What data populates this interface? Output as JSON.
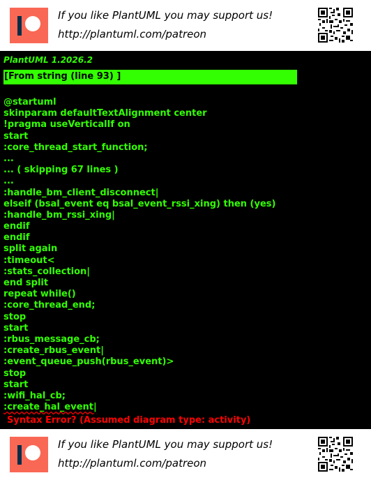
{
  "banner": {
    "line1": "If you like PlantUML you may support us!",
    "line2": "http://plantuml.com/patreon",
    "logo_icon": "patreon-logo-icon",
    "qr_icon": "qr-code-icon",
    "logo_color": "#f96854"
  },
  "console": {
    "version": "PlantUML 1.2026.2",
    "source": "[From string (line 93) ]",
    "lines": [
      "@startuml",
      "skinparam defaultTextAlignment center",
      "!pragma useVerticalIf on",
      "start",
      ":core_thread_start_function;",
      "...",
      "... ( skipping 67 lines )",
      "...",
      ":handle_bm_client_disconnect|",
      "elseif (bsal_event eq bsal_event_rssi_xing) then (yes)",
      ":handle_bm_rssi_xing|",
      "endif",
      "endif",
      "split again",
      ":timeout<",
      ":stats_collection|",
      "end split",
      "repeat while()",
      ":core_thread_end;",
      "stop",
      "start",
      ":rbus_message_cb;",
      ":create_rbus_event|",
      ":event_queue_push(rbus_event)>",
      "stop",
      "start",
      ":wifi_hal_cb;",
      ":create_hal_event|"
    ],
    "error": "Syntax Error? (Assumed diagram type: activity)",
    "text_color": "#33ff02",
    "error_color": "#ff0000",
    "background": "#000000"
  }
}
